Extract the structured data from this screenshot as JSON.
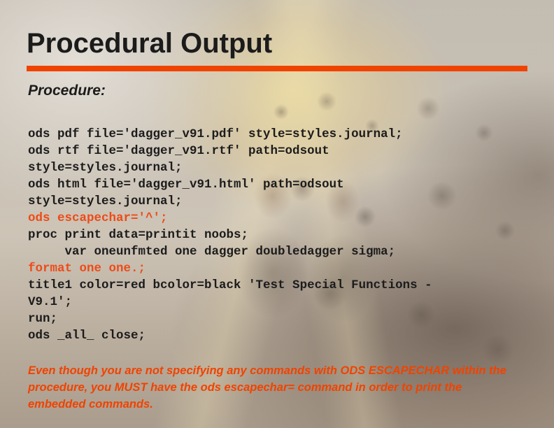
{
  "slide": {
    "title": "Procedural Output",
    "subhead": "Procedure:",
    "accent_color": "#f04300",
    "code_lines": [
      {
        "text": "ods pdf file='dagger_v91.pdf' style=styles.journal;",
        "color": "dark"
      },
      {
        "text": "ods rtf file='dagger_v91.rtf' path=odsout",
        "color": "dark"
      },
      {
        "text": "style=styles.journal;",
        "color": "dark"
      },
      {
        "text": "ods html file='dagger_v91.html' path=odsout",
        "color": "dark"
      },
      {
        "text": "style=styles.journal;",
        "color": "dark"
      },
      {
        "text": "ods escapechar='^';",
        "color": "orange"
      },
      {
        "text": "proc print data=printit noobs;",
        "color": "dark"
      },
      {
        "text": "     var oneunfmted one dagger doubledagger sigma;",
        "color": "dark"
      },
      {
        "text": "format one one.;",
        "color": "orange"
      },
      {
        "text": "title1 color=red bcolor=black 'Test Special Functions -",
        "color": "dark"
      },
      {
        "text": "V9.1';",
        "color": "dark"
      },
      {
        "text": "run;",
        "color": "dark"
      },
      {
        "text": "ods _all_ close;",
        "color": "dark"
      }
    ],
    "footnote": "Even though you are not specifying any commands with ODS ESCAPECHAR within the procedure, you MUST have the ods escapechar= command in order to print the embedded commands."
  }
}
